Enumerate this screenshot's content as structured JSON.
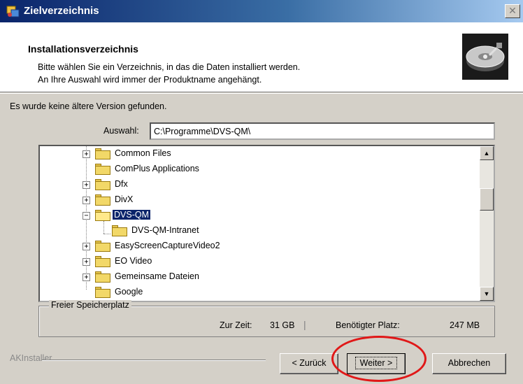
{
  "window": {
    "title": "Zielverzeichnis",
    "close_glyph": "✕",
    "app_icon": "installer-icon"
  },
  "header": {
    "title": "Installationsverzeichnis",
    "line1": "Bitte wählen Sie ein Verzeichnis, in das die Daten installiert werden.",
    "line2": "An Ihre Auswahl wird immer der Produktname angehängt.",
    "icon": "hard-disk-icon"
  },
  "status_text": "Es wurde keine ältere Version gefunden.",
  "selection": {
    "label": "Auswahl:",
    "value": "C:\\Programme\\DVS-QM\\"
  },
  "tree": {
    "items": [
      {
        "label": "Common Files",
        "expander": "+"
      },
      {
        "label": "ComPlus Applications",
        "expander": ""
      },
      {
        "label": "Dfx",
        "expander": "+"
      },
      {
        "label": "DivX",
        "expander": "+"
      },
      {
        "label": "DVS-QM",
        "expander": "−",
        "selected": true
      },
      {
        "label": "DVS-QM-Intranet",
        "expander": "",
        "child": true
      },
      {
        "label": "EasyScreenCaptureVideo2",
        "expander": "+"
      },
      {
        "label": "EO Video",
        "expander": "+"
      },
      {
        "label": "Gemeinsame Dateien",
        "expander": "+"
      },
      {
        "label": "Google",
        "expander": ""
      }
    ],
    "scroll_up": "▲",
    "scroll_down": "▼"
  },
  "space": {
    "legend": "Freier Speicherplatz",
    "current_label": "Zur Zeit:",
    "current_value": "31 GB",
    "separator": "|",
    "required_label": "Benötigter Platz:",
    "required_value": "247 MB"
  },
  "footer": {
    "brand": "AKInstaller",
    "back_label": "< Zurück",
    "next_label": "Weiter >",
    "cancel_label": "Abbrechen"
  },
  "colors": {
    "titlebar_start": "#0a246a",
    "selection": "#0a246a",
    "highlight_ring": "#e01818"
  }
}
